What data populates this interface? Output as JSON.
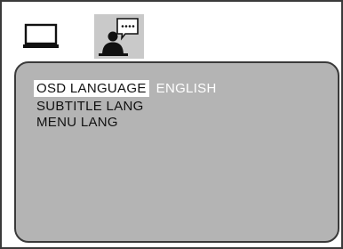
{
  "tabs": [
    {
      "icon": "monitor-icon",
      "active": false
    },
    {
      "icon": "person-speech-bubble-icon",
      "active": true
    }
  ],
  "menu": {
    "items": [
      {
        "label": "OSD LANGUAGE",
        "value": "ENGLISH",
        "selected": true
      },
      {
        "label": "SUBTITLE LANG",
        "value": "",
        "selected": false
      },
      {
        "label": "MENU LANG",
        "value": "",
        "selected": false
      }
    ]
  },
  "colors": {
    "panel_background": "#b4b4b4",
    "selected_tab_background": "#c9c9c9",
    "highlight": "#ffffff",
    "border": "#3a3a3a"
  }
}
